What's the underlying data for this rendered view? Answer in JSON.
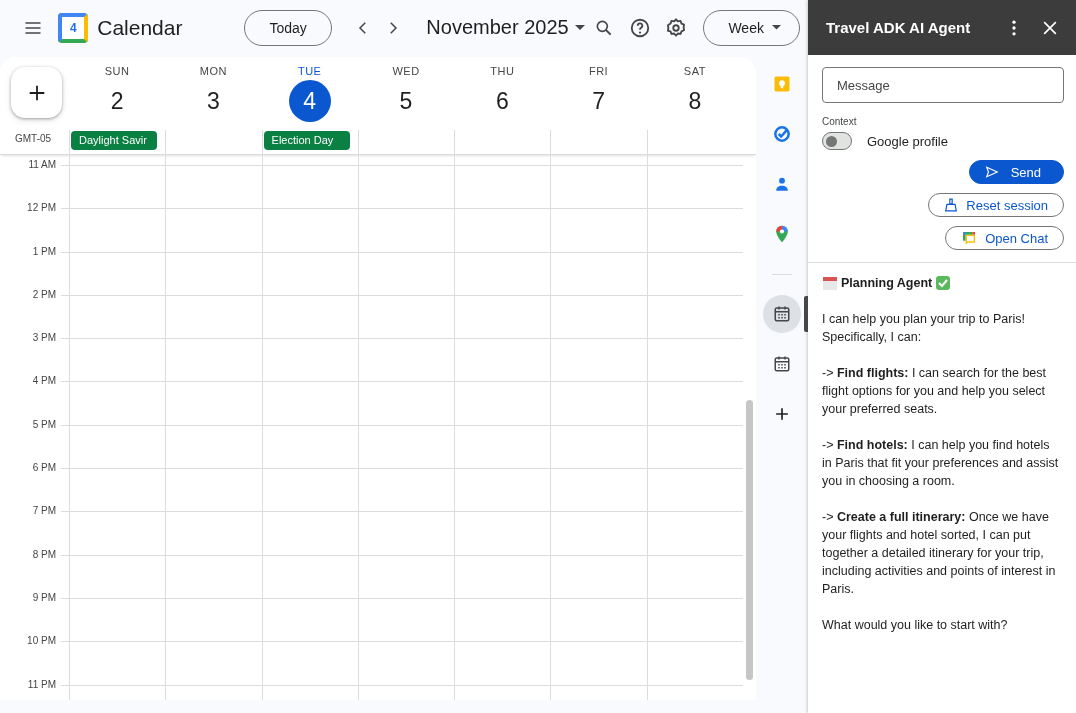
{
  "app_bar": {
    "title": "Calendar",
    "logo_day": "4",
    "today_button": "Today",
    "period": "November 2025",
    "view_selector": "Week"
  },
  "timezone_label": "GMT-05",
  "days": [
    {
      "weekday": "SUN",
      "date": "2",
      "selected": false,
      "events": [
        "Daylight Savir"
      ]
    },
    {
      "weekday": "MON",
      "date": "3",
      "selected": false
    },
    {
      "weekday": "TUE",
      "date": "4",
      "selected": true,
      "events": [
        "Election Day"
      ]
    },
    {
      "weekday": "WED",
      "date": "5",
      "selected": false
    },
    {
      "weekday": "THU",
      "date": "6",
      "selected": false
    },
    {
      "weekday": "FRI",
      "date": "7",
      "selected": false
    },
    {
      "weekday": "SAT",
      "date": "8",
      "selected": false
    }
  ],
  "hours": [
    "11 AM",
    "12 PM",
    "1 PM",
    "2 PM",
    "3 PM",
    "4 PM",
    "5 PM",
    "6 PM",
    "7 PM",
    "8 PM",
    "9 PM",
    "10 PM",
    "11 PM"
  ],
  "side_apps": [
    {
      "kind": "keep",
      "selected": false
    },
    {
      "kind": "tasks",
      "selected": false
    },
    {
      "kind": "contacts",
      "selected": false
    },
    {
      "kind": "maps",
      "selected": false
    },
    {
      "kind": "divider"
    },
    {
      "kind": "agent",
      "selected": true
    },
    {
      "kind": "calendar",
      "selected": false
    },
    {
      "kind": "add",
      "selected": false
    }
  ],
  "agent_panel": {
    "title": "Travel ADK AI Agent",
    "message_placeholder": "Message",
    "context_label": "Context",
    "google_profile": {
      "label": "Google profile",
      "on": false
    },
    "buttons": [
      {
        "kind": "send",
        "label": "Send"
      },
      {
        "kind": "reset",
        "label": "Reset session"
      },
      {
        "kind": "chat",
        "label": "Open Chat"
      }
    ],
    "response": {
      "heading": "Planning Agent",
      "paragraphs": [
        "I can help you plan your trip to Paris! Specifically, I can:",
        "-> **Find flights:** I can search for the best flight options for you and help you select your preferred seats.",
        "-> **Find hotels:** I can help you find hotels in Paris that fit your preferences and assist you in choosing a room.",
        "-> **Create a full itinerary:** Once we have your flights and hotel sorted, I can put together a detailed itinerary for your trip, including activities and points of interest in Paris.",
        "What would you like to start with?"
      ]
    }
  }
}
